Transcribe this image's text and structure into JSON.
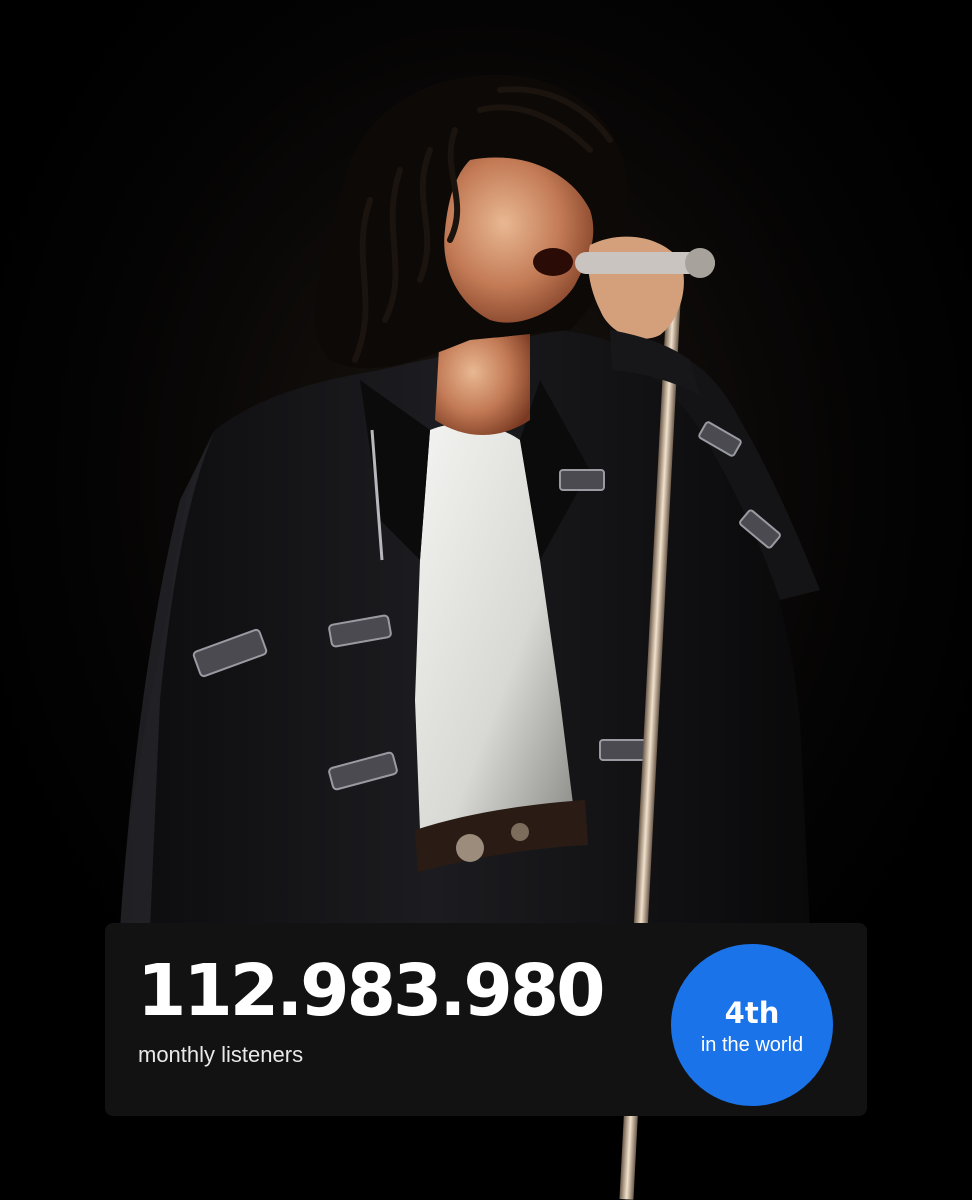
{
  "artist_photo": {
    "description_icon": "performer-photo",
    "background_color": "#020202"
  },
  "stats": {
    "monthly_listeners": "112.983.980",
    "monthly_listeners_label": "monthly listeners",
    "rank": "4th",
    "rank_caption": "in the world"
  },
  "colors": {
    "card_background": "#121212",
    "badge_background": "#1a73e8",
    "text_primary": "#ffffff",
    "text_secondary": "#e8e8e8"
  }
}
